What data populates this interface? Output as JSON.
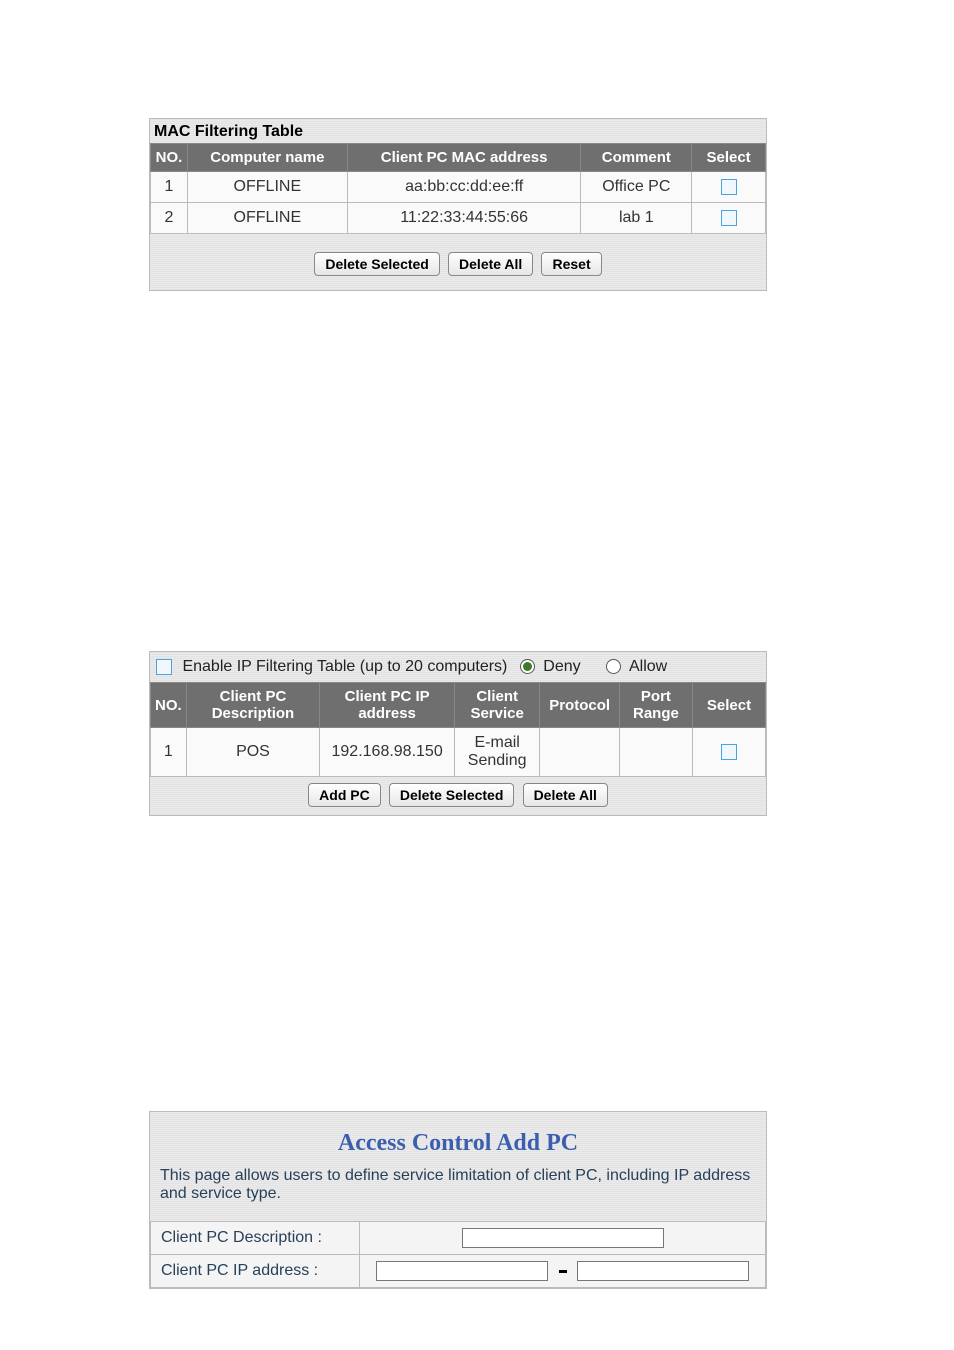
{
  "mac_table": {
    "title": "MAC Filtering Table",
    "headers": {
      "no": "NO.",
      "name": "Computer name",
      "mac": "Client PC MAC address",
      "comment": "Comment",
      "select": "Select"
    },
    "rows": [
      {
        "no": "1",
        "name": "OFFLINE",
        "mac": "aa:bb:cc:dd:ee:ff",
        "comment": "Office PC"
      },
      {
        "no": "2",
        "name": "OFFLINE",
        "mac": "11:22:33:44:55:66",
        "comment": "lab 1"
      }
    ],
    "buttons": {
      "delete_selected": "Delete Selected",
      "delete_all": "Delete All",
      "reset": "Reset"
    }
  },
  "ip_table": {
    "enable_label": "Enable IP Filtering Table (up to 20 computers)",
    "deny_label": "Deny",
    "allow_label": "Allow",
    "headers": {
      "no": "NO.",
      "desc": "Client PC Description",
      "ip": "Client PC IP address",
      "service": "Client Service",
      "protocol": "Protocol",
      "port": "Port Range",
      "select": "Select"
    },
    "rows": [
      {
        "no": "1",
        "desc": "POS",
        "ip": "192.168.98.150",
        "service": "E-mail Sending",
        "protocol": "",
        "port": ""
      }
    ],
    "buttons": {
      "add_pc": "Add PC",
      "delete_selected": "Delete Selected",
      "delete_all": "Delete All"
    }
  },
  "access_control": {
    "title": "Access Control Add PC",
    "description": "This page allows users to define service limitation of client PC, including IP address and service type.",
    "labels": {
      "desc": "Client PC Description :",
      "ip": "Client PC IP address :"
    }
  }
}
